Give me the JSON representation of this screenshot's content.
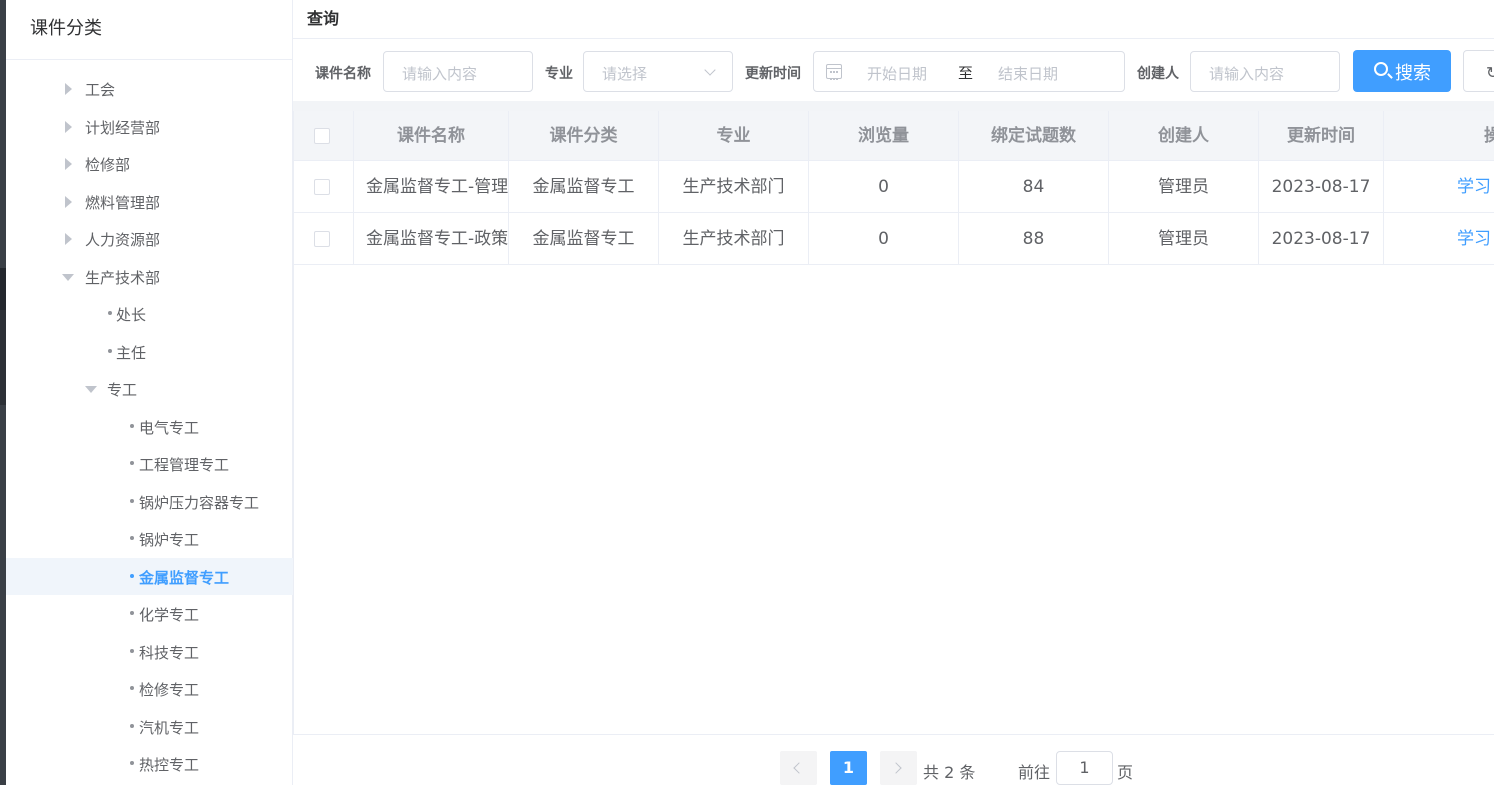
{
  "sidebar": {
    "title": "课件分类",
    "items": [
      {
        "label": "工会",
        "kind": "collapsed",
        "level": 1
      },
      {
        "label": "计划经营部",
        "kind": "collapsed",
        "level": 1
      },
      {
        "label": "检修部",
        "kind": "collapsed",
        "level": 1
      },
      {
        "label": "燃料管理部",
        "kind": "collapsed",
        "level": 1
      },
      {
        "label": "人力资源部",
        "kind": "collapsed",
        "level": 1
      },
      {
        "label": "生产技术部",
        "kind": "expanded",
        "level": 1
      },
      {
        "label": "处长",
        "kind": "leaf",
        "level": 2
      },
      {
        "label": "主任",
        "kind": "leaf",
        "level": 2
      },
      {
        "label": "专工",
        "kind": "expanded",
        "level": 2
      },
      {
        "label": "电气专工",
        "kind": "leaf",
        "level": 3
      },
      {
        "label": "工程管理专工",
        "kind": "leaf",
        "level": 3
      },
      {
        "label": "锅炉压力容器专工",
        "kind": "leaf",
        "level": 3
      },
      {
        "label": "锅炉专工",
        "kind": "leaf",
        "level": 3
      },
      {
        "label": "金属监督专工",
        "kind": "leaf",
        "level": 3,
        "active": true
      },
      {
        "label": "化学专工",
        "kind": "leaf",
        "level": 3
      },
      {
        "label": "科技专工",
        "kind": "leaf",
        "level": 3
      },
      {
        "label": "检修专工",
        "kind": "leaf",
        "level": 3
      },
      {
        "label": "汽机专工",
        "kind": "leaf",
        "level": 3
      },
      {
        "label": "热控专工",
        "kind": "leaf",
        "level": 3
      }
    ]
  },
  "query": {
    "title": "查询",
    "name_label": "课件名称",
    "name_placeholder": "请输入内容",
    "major_label": "专业",
    "major_placeholder": "请选择",
    "time_label": "更新时间",
    "start_placeholder": "开始日期",
    "range_separator": "至",
    "end_placeholder": "结束日期",
    "creator_label": "创建人",
    "creator_placeholder": "请输入内容",
    "search_label": "搜索"
  },
  "table": {
    "columns": [
      "课件名称",
      "课件分类",
      "专业",
      "浏览量",
      "绑定试题数",
      "创建人",
      "更新时间",
      "操"
    ],
    "rows": [
      {
        "name": "金属监督专工-管理",
        "category": "金属监督专工",
        "major": "生产技术部门",
        "views": "0",
        "questions": "84",
        "creator": "管理员",
        "updated": "2023-08-17",
        "action": "学习"
      },
      {
        "name": "金属监督专工-政策",
        "category": "金属监督专工",
        "major": "生产技术部门",
        "views": "0",
        "questions": "88",
        "creator": "管理员",
        "updated": "2023-08-17",
        "action": "学习"
      }
    ]
  },
  "pagination": {
    "current_page": "1",
    "total_text": "共 2 条",
    "goto_label": "前往",
    "goto_value": "1",
    "page_suffix": "页"
  },
  "colors": {
    "accent": "#409eff",
    "header_bg": "#f3f5f8",
    "active_bg": "#f0f5fb"
  }
}
